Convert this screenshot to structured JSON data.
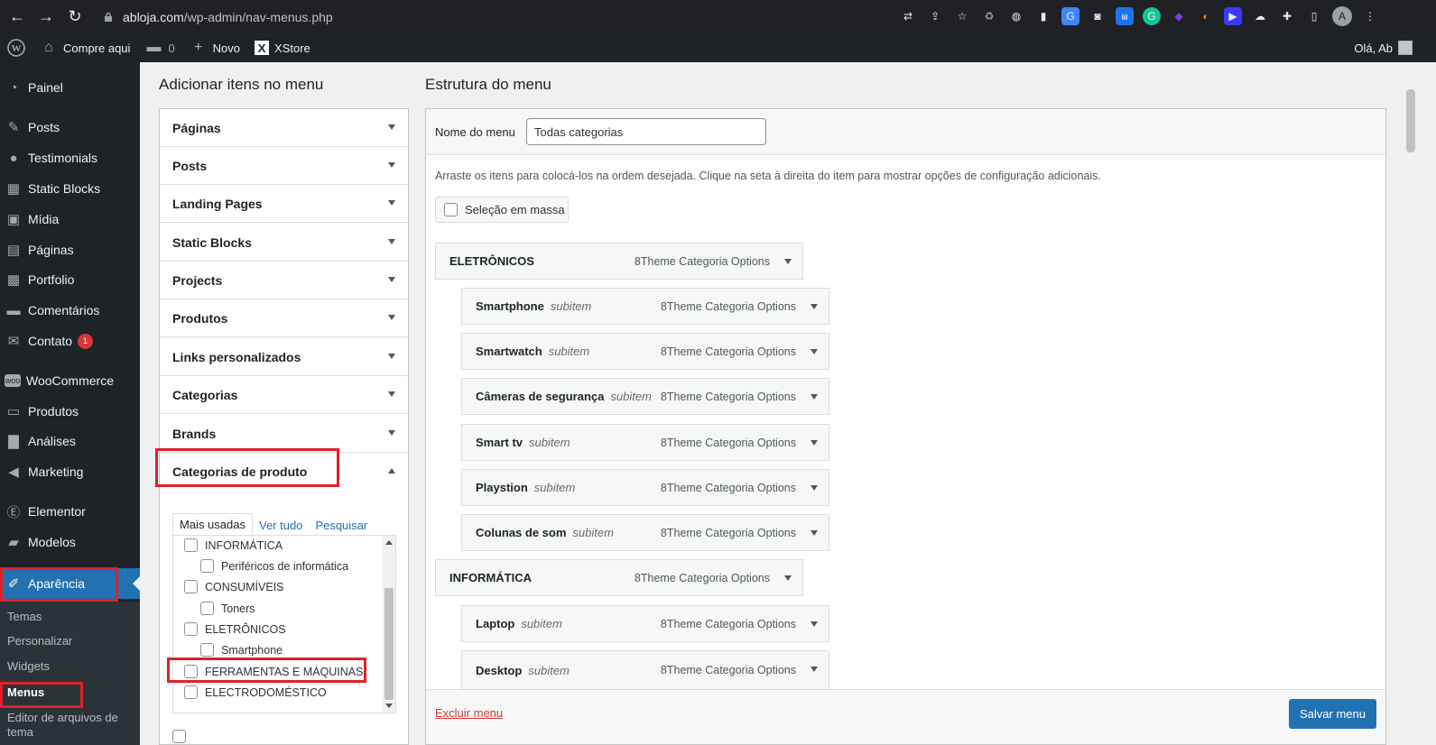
{
  "browser": {
    "url_host": "abloja.com",
    "url_path": "/wp-admin/nav-menus.php",
    "profile_initial": "A"
  },
  "admin_bar": {
    "site_name": "Compre aqui",
    "comments_count": "0",
    "new_label": "Novo",
    "theme_label": "XStore",
    "greeting": "Olá, Ab"
  },
  "sidebar": {
    "items": [
      {
        "label": "Painel",
        "icon": "dashboard-icon"
      },
      {
        "label": "Posts",
        "icon": "pin-icon"
      },
      {
        "label": "Testimonials",
        "icon": "speech-bubble-icon"
      },
      {
        "label": "Static Blocks",
        "icon": "grid-icon"
      },
      {
        "label": "Mídia",
        "icon": "media-icon"
      },
      {
        "label": "Páginas",
        "icon": "pages-icon"
      },
      {
        "label": "Portfolio",
        "icon": "portfolio-icon"
      },
      {
        "label": "Comentários",
        "icon": "comment-icon"
      },
      {
        "label": "Contato",
        "icon": "mail-icon",
        "badge": "1"
      },
      {
        "label": "WooCommerce",
        "icon": "woo-icon"
      },
      {
        "label": "Produtos",
        "icon": "archive-icon"
      },
      {
        "label": "Análises",
        "icon": "bar-chart-icon"
      },
      {
        "label": "Marketing",
        "icon": "megaphone-icon"
      },
      {
        "label": "Elementor",
        "icon": "elementor-icon"
      },
      {
        "label": "Modelos",
        "icon": "folder-icon"
      },
      {
        "label": "Aparência",
        "icon": "brush-icon"
      }
    ],
    "submenu": [
      "Temas",
      "Personalizar",
      "Widgets",
      "Menus",
      "Editor de arquivos de tema"
    ]
  },
  "left": {
    "title": "Adicionar itens no menu",
    "sections": [
      "Páginas",
      "Posts",
      "Landing Pages",
      "Static Blocks",
      "Projects",
      "Produtos",
      "Links personalizados",
      "Categorias",
      "Brands",
      "Categorias de produto"
    ],
    "tabs": [
      "Mais usadas",
      "Ver tudo",
      "Pesquisar"
    ],
    "categories": [
      {
        "label": "INFORMÁTICA",
        "level": 0
      },
      {
        "label": "Periféricos de informática",
        "level": 1
      },
      {
        "label": "CONSUMÍVEIS",
        "level": 0
      },
      {
        "label": "Toners",
        "level": 1
      },
      {
        "label": "ELETRÔNICOS",
        "level": 0
      },
      {
        "label": "Smartphone",
        "level": 1
      },
      {
        "label": "FERRAMENTAS E MÁQUINAS",
        "level": 0
      },
      {
        "label": "ELECTRODOMÉSTICO",
        "level": 0
      }
    ]
  },
  "right": {
    "title": "Estrutura do menu",
    "menu_name_label": "Nome do menu",
    "menu_name_value": "Todas categorias",
    "instructions": "Arraste os itens para colocá-los na ordem desejada. Clique na seta à direita do item para mostrar opções de configuração adicionais.",
    "bulk_select_label": "Seleção em massa",
    "item_type": "8Theme Categoria Options",
    "subitem_label": "subitem",
    "items": [
      {
        "label": "ELETRÔNICOS",
        "depth": 0
      },
      {
        "label": "Smartphone",
        "depth": 1
      },
      {
        "label": "Smartwatch",
        "depth": 1
      },
      {
        "label": "Câmeras de segurança",
        "depth": 1
      },
      {
        "label": "Smart tv",
        "depth": 1
      },
      {
        "label": "Playstion",
        "depth": 1
      },
      {
        "label": "Colunas de som",
        "depth": 1
      },
      {
        "label": "INFORMÁTICA",
        "depth": 0
      },
      {
        "label": "Laptop",
        "depth": 1
      },
      {
        "label": "Desktop",
        "depth": 1
      }
    ],
    "delete_label": "Excluir menu",
    "save_label": "Salvar menu"
  },
  "colors": {
    "accent": "#2271b1",
    "highlight_box": "#e0202a",
    "admin_dark": "#1d2327"
  }
}
